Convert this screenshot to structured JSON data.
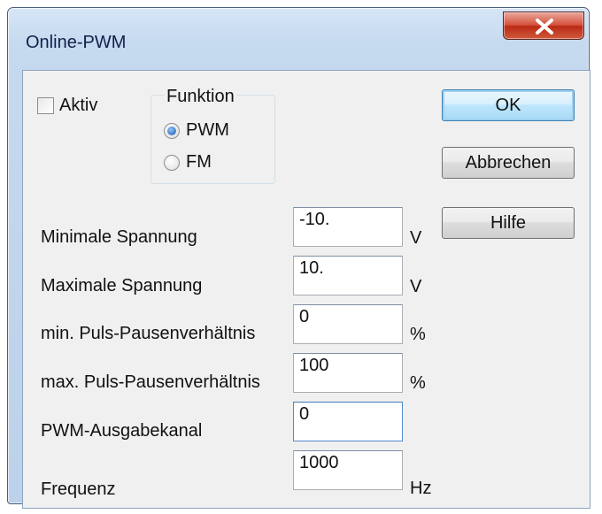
{
  "window": {
    "title": "Online-PWM",
    "close_icon": "close-x-icon"
  },
  "aktiv": {
    "label": "Aktiv",
    "checked": false
  },
  "funktion": {
    "title": "Funktion",
    "options": [
      {
        "label": "PWM",
        "selected": true
      },
      {
        "label": "FM",
        "selected": false
      }
    ]
  },
  "buttons": {
    "ok": "OK",
    "cancel": "Abbrechen",
    "help": "Hilfe"
  },
  "fields": [
    {
      "label": "Minimale Spannung",
      "value": "-10.",
      "unit": "V"
    },
    {
      "label": "Maximale Spannung",
      "value": "10.",
      "unit": "V"
    },
    {
      "label": "min. Puls-Pausenverhältnis",
      "value": "0",
      "unit": "%"
    },
    {
      "label": "max. Puls-Pausenverhältnis",
      "value": "100",
      "unit": "%"
    },
    {
      "label": "PWM-Ausgabekanal",
      "value": "0",
      "unit": ""
    },
    {
      "label": "Frequenz",
      "value": "1000",
      "unit": "Hz"
    }
  ],
  "colors": {
    "frame": "#c5d9ef",
    "close_button": "#c9452f",
    "dialog_background": "#f0f0f0",
    "radio_selected": "#1656a8"
  }
}
